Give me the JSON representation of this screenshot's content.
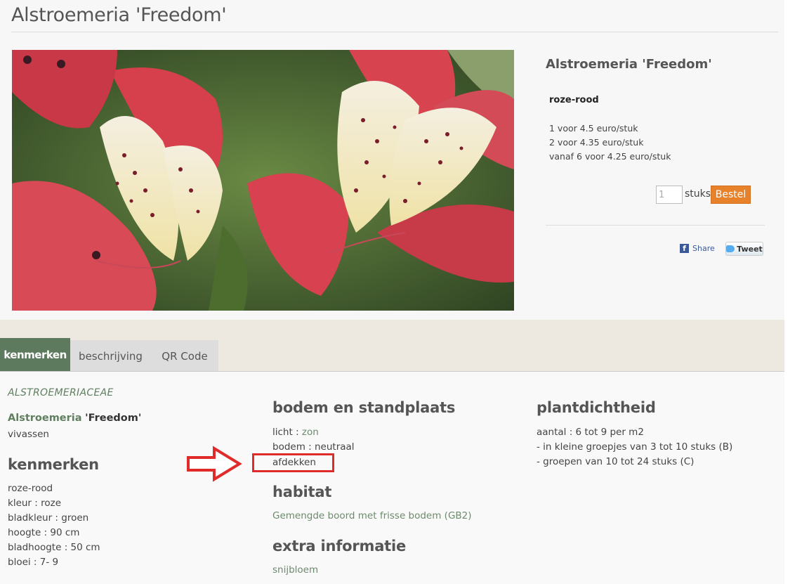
{
  "page": {
    "title": "Alstroemeria 'Freedom'"
  },
  "product": {
    "name": "Alstroemeria 'Freedom'",
    "color": "roze-rood",
    "prices": [
      "1 voor 4.5 euro/stuk",
      "2 voor 4.35 euro/stuk",
      "vanaf 6 voor 4.25 euro/stuk"
    ],
    "quantity": "1",
    "quantity_unit": "stuks",
    "order_button": "Bestel",
    "share_label": "Share",
    "tweet_label": "Tweet",
    "accent_color": "#e8822a"
  },
  "tabs": [
    {
      "label": "kenmerken",
      "active": true
    },
    {
      "label": "beschrijving",
      "active": false
    },
    {
      "label": "QR Code",
      "active": false
    }
  ],
  "details": {
    "family": "ALSTROEMERIACEAE",
    "genus": "Alstroemeria",
    "cultivar": "'Freedom'",
    "category": "vivassen",
    "kenmerken_heading": "kenmerken",
    "kenmerken": [
      "roze-rood",
      "kleur : roze",
      "bladkleur : groen",
      "hoogte : 90 cm",
      "bladhoogte : 50 cm",
      "bloei : 7- 9"
    ],
    "bodem_heading": "bodem en standplaats",
    "licht_label": "licht : ",
    "licht_value": "zon",
    "bodem": "bodem : neutraal",
    "afdekken": "afdekken",
    "habitat_heading": "habitat",
    "habitat": "Gemengde boord met frisse bodem (GB2)",
    "extra_heading": "extra informatie",
    "extra": "snijbloem",
    "plantdichtheid_heading": "plantdichtheid",
    "plantdichtheid": [
      "aantal : 6 tot 9 per m2",
      "- in kleine groepjes van 3 tot 10 stuks (B)",
      "- groepen van 10 tot 24 stuks (C)"
    ]
  },
  "icons": [
    "facebook-icon",
    "twitter-icon",
    "red-arrow-annotation"
  ]
}
